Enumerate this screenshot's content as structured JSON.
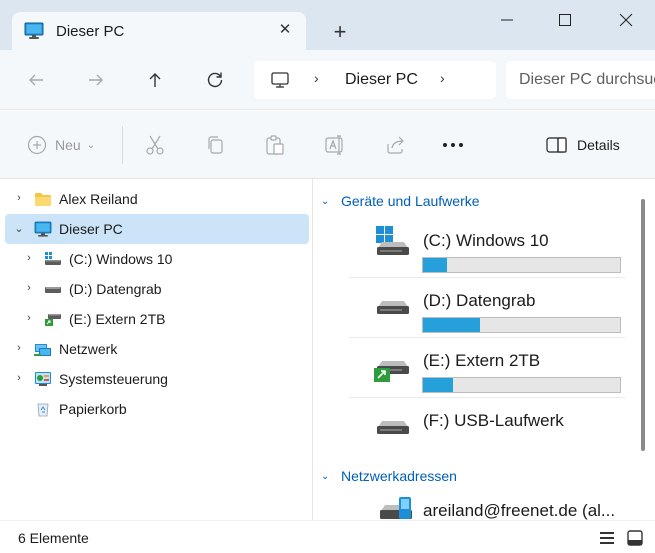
{
  "colors": {
    "accent": "#005fb8",
    "selection": "#cce4f7",
    "drive_bar": "#26a0da",
    "titlebar": "#dce6f0"
  },
  "window": {
    "tab_title": "Dieser PC",
    "tab_icon": "monitor-icon",
    "close_tab_symbol": "✕",
    "new_tab_symbol": "+"
  },
  "address": {
    "crumb": "Dieser PC",
    "separator": "›",
    "search_placeholder": "Dieser PC durchsuchen"
  },
  "commands": {
    "new_label": "Neu",
    "new_caret": "⌄",
    "details_label": "Details",
    "icons": [
      "cut-icon",
      "copy-icon",
      "paste-icon",
      "rename-icon",
      "share-icon",
      "more-icon"
    ]
  },
  "tree": [
    {
      "label": "Alex Reiland",
      "icon": "folder-icon",
      "expanded": false,
      "chevron": "›"
    },
    {
      "label": "Dieser PC",
      "icon": "monitor-icon",
      "expanded": true,
      "chevron": "⌄",
      "selected": true
    },
    {
      "label": "(C:) Windows 10",
      "icon": "drive-icon",
      "chevron": "›"
    },
    {
      "label": "(D:) Datengrab",
      "icon": "drive-icon",
      "chevron": "›"
    },
    {
      "label": "(E:) Extern 2TB",
      "icon": "external-drive-icon",
      "chevron": "›"
    },
    {
      "label": "Netzwerk",
      "icon": "network-icon",
      "chevron": "›"
    },
    {
      "label": "Systemsteuerung",
      "icon": "control-panel-icon",
      "chevron": "›"
    },
    {
      "label": "Papierkorb",
      "icon": "recycle-bin-icon",
      "chevron": ""
    }
  ],
  "content": {
    "group_devices": "Geräte und Laufwerke",
    "group_network": "Netzwerkadressen",
    "drives": [
      {
        "label": "(C:) Windows 10",
        "used_fraction": 0.12,
        "icon": "windows-drive-icon"
      },
      {
        "label": "(D:) Datengrab",
        "used_fraction": 0.29,
        "icon": "drive-icon"
      },
      {
        "label": "(E:) Extern 2TB",
        "used_fraction": 0.15,
        "icon": "external-drive-icon"
      },
      {
        "label": "(F:) USB-Laufwerk",
        "used_fraction": null,
        "icon": "drive-icon"
      }
    ],
    "network_location": "areiland@freenet.de (al..."
  },
  "status": {
    "item_count": "6 Elemente"
  }
}
